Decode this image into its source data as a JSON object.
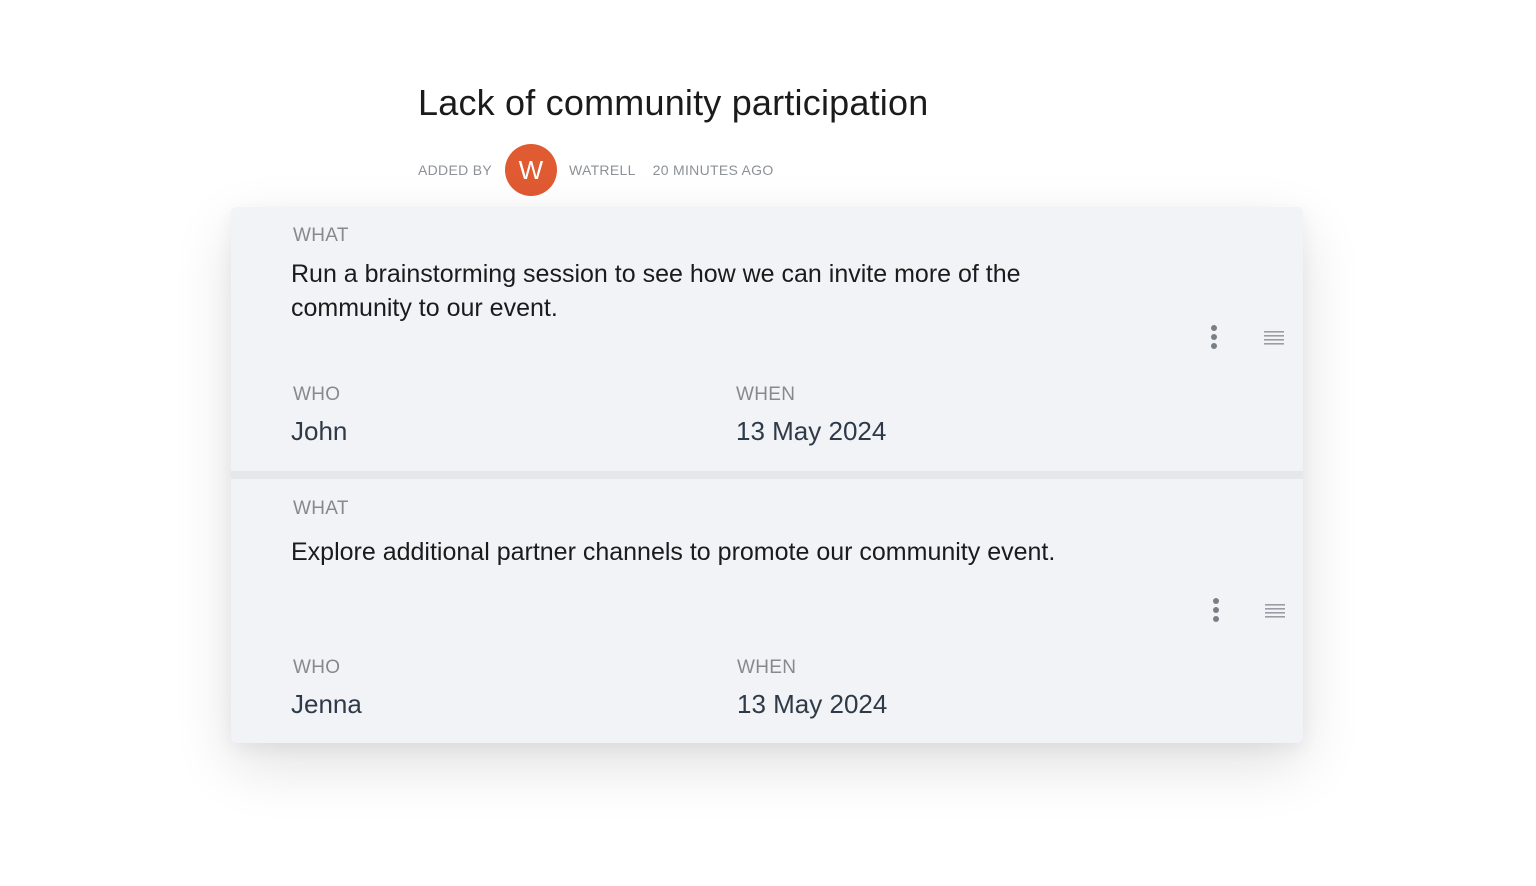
{
  "header": {
    "title": "Lack of community participation",
    "added_by_label": "ADDED BY",
    "avatar_initial": "W",
    "author": "WATRELL",
    "timestamp": "20 MINUTES AGO",
    "avatar_color": "#e05a32"
  },
  "actions": [
    {
      "what_label": "WHAT",
      "what": "Run a brainstorming session to see how we can invite more of the community to our event.",
      "who_label": "WHO",
      "who": "John",
      "when_label": "WHEN",
      "when": "13 May 2024",
      "menu_icon": "kebab-menu-icon",
      "drag_icon": "drag-handle-icon"
    },
    {
      "what_label": "WHAT",
      "what": "Explore additional partner channels to promote our community event.",
      "who_label": "WHO",
      "who": "Jenna",
      "when_label": "WHEN",
      "when": "13 May 2024",
      "menu_icon": "kebab-menu-icon",
      "drag_icon": "drag-handle-icon"
    }
  ]
}
